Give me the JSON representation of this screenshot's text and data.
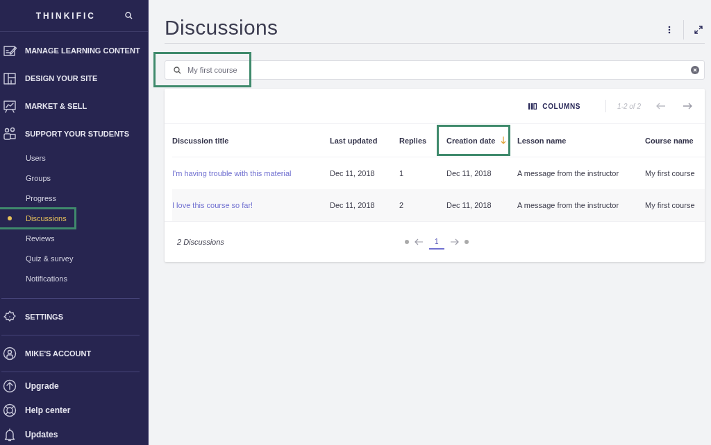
{
  "sidebar": {
    "logo": "THINKIFIC",
    "sections": [
      {
        "label": "MANAGE LEARNING CONTENT"
      },
      {
        "label": "DESIGN YOUR SITE"
      },
      {
        "label": "MARKET & SELL"
      },
      {
        "label": "SUPPORT YOUR STUDENTS",
        "children": [
          {
            "label": "Users",
            "selected": false,
            "highlighted": false
          },
          {
            "label": "Groups",
            "selected": false,
            "highlighted": false
          },
          {
            "label": "Progress",
            "selected": false,
            "highlighted": false
          },
          {
            "label": "Discussions",
            "selected": true,
            "highlighted": true
          },
          {
            "label": "Reviews",
            "selected": false,
            "highlighted": false
          },
          {
            "label": "Quiz & survey",
            "selected": false,
            "highlighted": false
          },
          {
            "label": "Notifications",
            "selected": false,
            "highlighted": false
          }
        ]
      }
    ],
    "settings": {
      "label": "SETTINGS"
    },
    "account": {
      "label": "MIKE'S ACCOUNT"
    },
    "links": [
      {
        "label": "Upgrade"
      },
      {
        "label": "Help center"
      },
      {
        "label": "Updates"
      }
    ]
  },
  "page": {
    "title": "Discussions",
    "search": {
      "value": "My first course",
      "highlighted": true
    },
    "toolbar": {
      "columns_button": "COLUMNS",
      "range": "1-2 of 2"
    },
    "table": {
      "columns": [
        {
          "label": "Discussion title",
          "sorted": false,
          "highlighted": false
        },
        {
          "label": "Last updated",
          "sorted": false,
          "highlighted": false
        },
        {
          "label": "Replies",
          "sorted": false,
          "highlighted": false
        },
        {
          "label": "Creation date",
          "sorted": true,
          "highlighted": true
        },
        {
          "label": "Lesson name",
          "sorted": false,
          "highlighted": false
        },
        {
          "label": "Course name",
          "sorted": false,
          "highlighted": false
        }
      ],
      "rows": [
        [
          "I'm having trouble with this material",
          "Dec 11, 2018",
          "1",
          "Dec 11, 2018",
          "A message from the instructor",
          "My first course"
        ],
        [
          "I love this course so far!",
          "Dec 11, 2018",
          "2",
          "Dec 11, 2018",
          "A message from the instructor",
          "My first course"
        ]
      ]
    },
    "footer": {
      "count": "2 Discussions",
      "pages": [
        {
          "label": "1",
          "selected": true
        }
      ]
    }
  }
}
